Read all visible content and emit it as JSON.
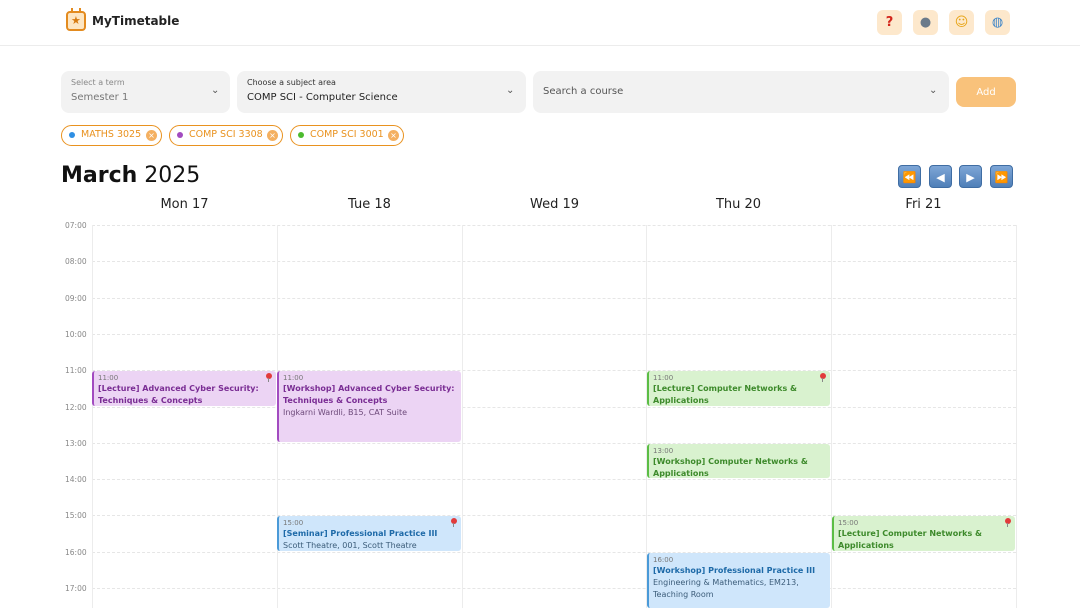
{
  "header": {
    "app_title": "MyTimetable"
  },
  "filters": {
    "term": {
      "label": "Select a term",
      "value": "Semester 1"
    },
    "subject": {
      "label": "Choose a subject area",
      "value": "COMP SCI - Computer Science"
    },
    "course": {
      "placeholder": "Search a course"
    },
    "add_label": "Add"
  },
  "chips": [
    {
      "label": "MATHS 3025",
      "dot_color": "#2f8fe3"
    },
    {
      "label": "COMP SCI 3308",
      "dot_color": "#a24bc0"
    },
    {
      "label": "COMP SCI 3001",
      "dot_color": "#4cbb2f"
    }
  ],
  "calendar": {
    "month": "March",
    "year": "2025",
    "days": [
      "Mon 17",
      "Tue 18",
      "Wed 19",
      "Thu 20",
      "Fri 21"
    ],
    "times": [
      "07:00",
      "08:00",
      "09:00",
      "10:00",
      "11:00",
      "12:00",
      "13:00",
      "14:00",
      "15:00",
      "16:00",
      "17:00"
    ]
  },
  "events": [
    {
      "time": "11:00",
      "title_1": "[Lecture] Advanced Cyber Security:",
      "title_2": "Techniques & Concepts",
      "color": "purple"
    },
    {
      "time": "11:00",
      "title_1": "[Workshop] Advanced Cyber Security:",
      "title_2": "Techniques & Concepts",
      "location": "Ingkarni Wardli, B15, CAT Suite",
      "color": "purple"
    },
    {
      "time": "15:00",
      "title_1": "[Seminar] Professional Practice III",
      "location": "Scott Theatre, 001, Scott Theatre",
      "color": "blue"
    },
    {
      "time": "11:00",
      "title_1": "[Lecture] Computer Networks &",
      "title_2": "Applications",
      "color": "green"
    },
    {
      "time": "13:00",
      "title_1": "[Workshop] Computer Networks &",
      "title_2": "Applications",
      "color": "green"
    },
    {
      "time": "16:00",
      "title_1": "[Workshop] Professional Practice III",
      "location_1": "Engineering & Mathematics, EM213,",
      "location_2": "Teaching Room",
      "color": "blue"
    },
    {
      "time": "15:00",
      "title_1": "[Lecture] Computer Networks &",
      "title_2": "Applications",
      "color": "green"
    }
  ]
}
